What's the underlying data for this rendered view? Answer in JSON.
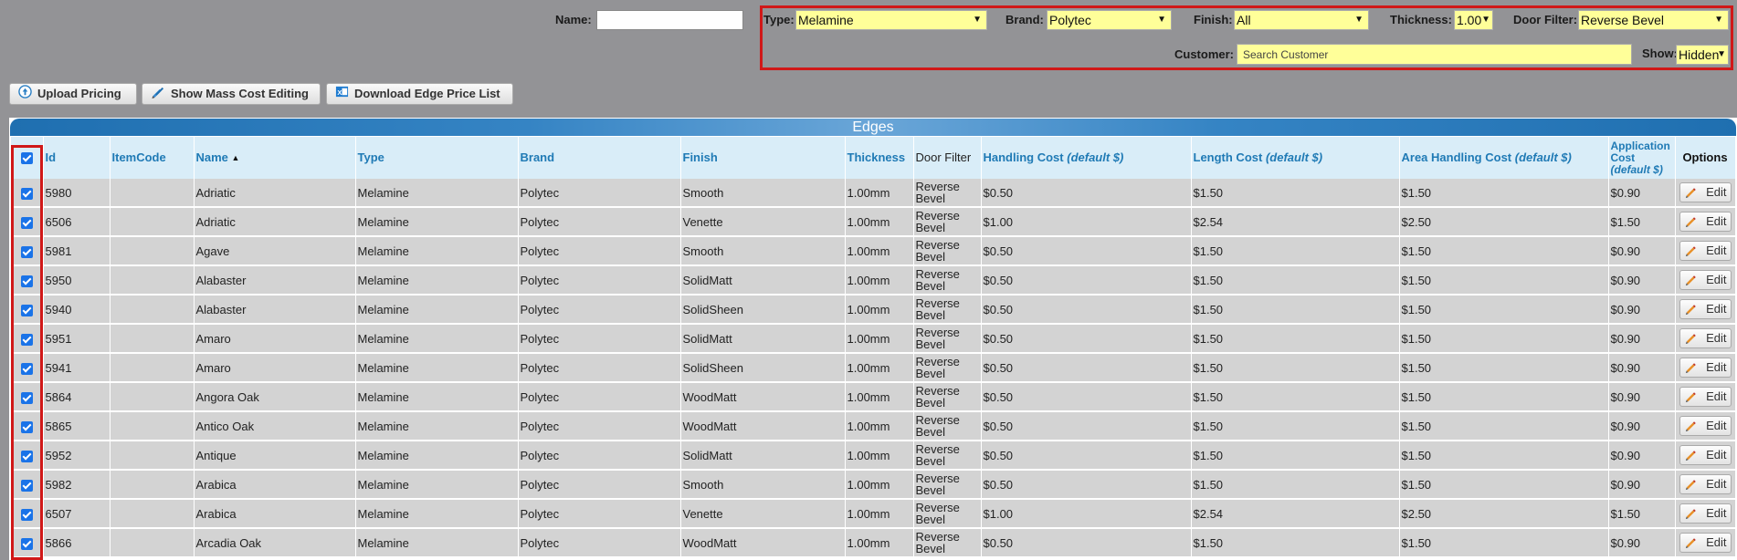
{
  "filters": {
    "name_label": "Name:",
    "name_value": "",
    "type_label": "Type:",
    "type_value": "Melamine",
    "brand_label": "Brand:",
    "brand_value": "Polytec",
    "finish_label": "Finish:",
    "finish_value": "All",
    "thickness_label": "Thickness:",
    "thickness_value": "1.00",
    "door_filter_label": "Door Filter:",
    "door_filter_value": "Reverse Bevel",
    "customer_label": "Customer:",
    "customer_placeholder": "Search Customer",
    "show_label": "Show:",
    "show_value": "Hidden"
  },
  "toolbar": {
    "upload_label": "Upload Pricing",
    "mass_cost_label": "Show Mass Cost Editing",
    "download_label": "Download Edge Price List"
  },
  "grid": {
    "title": "Edges",
    "columns": {
      "id": "Id",
      "itemcode": "ItemCode",
      "name": "Name",
      "type": "Type",
      "brand": "Brand",
      "finish": "Finish",
      "thickness": "Thickness",
      "door_filter": "Door Filter",
      "handling": "Handling Cost",
      "length": "Length Cost",
      "area": "Area Handling Cost",
      "application": "Application Cost",
      "default_note": "(default $)",
      "options": "Options"
    },
    "edit_label": "Edit",
    "rows": [
      {
        "id": "5980",
        "itemcode": "",
        "name": "Adriatic",
        "type": "Melamine",
        "brand": "Polytec",
        "finish": "Smooth",
        "thickness": "1.00mm",
        "door_filter": "Reverse Bevel",
        "handling": "$0.50",
        "length": "$1.50",
        "area": "$1.50",
        "application": "$0.90"
      },
      {
        "id": "6506",
        "itemcode": "",
        "name": "Adriatic",
        "type": "Melamine",
        "brand": "Polytec",
        "finish": "Venette",
        "thickness": "1.00mm",
        "door_filter": "Reverse Bevel",
        "handling": "$1.00",
        "length": "$2.54",
        "area": "$2.50",
        "application": "$1.50"
      },
      {
        "id": "5981",
        "itemcode": "",
        "name": "Agave",
        "type": "Melamine",
        "brand": "Polytec",
        "finish": "Smooth",
        "thickness": "1.00mm",
        "door_filter": "Reverse Bevel",
        "handling": "$0.50",
        "length": "$1.50",
        "area": "$1.50",
        "application": "$0.90"
      },
      {
        "id": "5950",
        "itemcode": "",
        "name": "Alabaster",
        "type": "Melamine",
        "brand": "Polytec",
        "finish": "SolidMatt",
        "thickness": "1.00mm",
        "door_filter": "Reverse Bevel",
        "handling": "$0.50",
        "length": "$1.50",
        "area": "$1.50",
        "application": "$0.90"
      },
      {
        "id": "5940",
        "itemcode": "",
        "name": "Alabaster",
        "type": "Melamine",
        "brand": "Polytec",
        "finish": "SolidSheen",
        "thickness": "1.00mm",
        "door_filter": "Reverse Bevel",
        "handling": "$0.50",
        "length": "$1.50",
        "area": "$1.50",
        "application": "$0.90"
      },
      {
        "id": "5951",
        "itemcode": "",
        "name": "Amaro",
        "type": "Melamine",
        "brand": "Polytec",
        "finish": "SolidMatt",
        "thickness": "1.00mm",
        "door_filter": "Reverse Bevel",
        "handling": "$0.50",
        "length": "$1.50",
        "area": "$1.50",
        "application": "$0.90"
      },
      {
        "id": "5941",
        "itemcode": "",
        "name": "Amaro",
        "type": "Melamine",
        "brand": "Polytec",
        "finish": "SolidSheen",
        "thickness": "1.00mm",
        "door_filter": "Reverse Bevel",
        "handling": "$0.50",
        "length": "$1.50",
        "area": "$1.50",
        "application": "$0.90"
      },
      {
        "id": "5864",
        "itemcode": "",
        "name": "Angora Oak",
        "type": "Melamine",
        "brand": "Polytec",
        "finish": "WoodMatt",
        "thickness": "1.00mm",
        "door_filter": "Reverse Bevel",
        "handling": "$0.50",
        "length": "$1.50",
        "area": "$1.50",
        "application": "$0.90"
      },
      {
        "id": "5865",
        "itemcode": "",
        "name": "Antico Oak",
        "type": "Melamine",
        "brand": "Polytec",
        "finish": "WoodMatt",
        "thickness": "1.00mm",
        "door_filter": "Reverse Bevel",
        "handling": "$0.50",
        "length": "$1.50",
        "area": "$1.50",
        "application": "$0.90"
      },
      {
        "id": "5952",
        "itemcode": "",
        "name": "Antique",
        "type": "Melamine",
        "brand": "Polytec",
        "finish": "SolidMatt",
        "thickness": "1.00mm",
        "door_filter": "Reverse Bevel",
        "handling": "$0.50",
        "length": "$1.50",
        "area": "$1.50",
        "application": "$0.90"
      },
      {
        "id": "5982",
        "itemcode": "",
        "name": "Arabica",
        "type": "Melamine",
        "brand": "Polytec",
        "finish": "Smooth",
        "thickness": "1.00mm",
        "door_filter": "Reverse Bevel",
        "handling": "$0.50",
        "length": "$1.50",
        "area": "$1.50",
        "application": "$0.90"
      },
      {
        "id": "6507",
        "itemcode": "",
        "name": "Arabica",
        "type": "Melamine",
        "brand": "Polytec",
        "finish": "Venette",
        "thickness": "1.00mm",
        "door_filter": "Reverse Bevel",
        "handling": "$1.00",
        "length": "$2.54",
        "area": "$2.50",
        "application": "$1.50"
      },
      {
        "id": "5866",
        "itemcode": "",
        "name": "Arcadia Oak",
        "type": "Melamine",
        "brand": "Polytec",
        "finish": "WoodMatt",
        "thickness": "1.00mm",
        "door_filter": "Reverse Bevel",
        "handling": "$0.50",
        "length": "$1.50",
        "area": "$1.50",
        "application": "$0.90"
      }
    ]
  }
}
